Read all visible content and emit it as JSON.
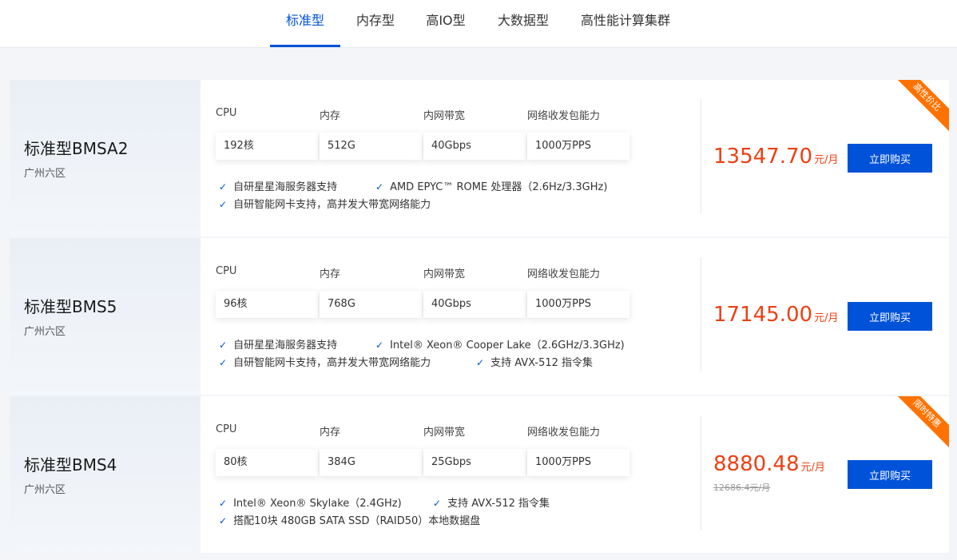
{
  "tabs": [
    {
      "label": "标准型",
      "active": true
    },
    {
      "label": "内存型",
      "active": false
    },
    {
      "label": "高IO型",
      "active": false
    },
    {
      "label": "大数据型",
      "active": false
    },
    {
      "label": "高性能计算集群",
      "active": false
    }
  ],
  "spec_labels": {
    "cpu": "CPU",
    "memory": "内存",
    "bandwidth": "内网带宽",
    "pps": "网络收发包能力"
  },
  "buy_label": "立即购买",
  "price_unit": "元/月",
  "colors": {
    "accent": "#0052d9",
    "price": "#ed4014",
    "ribbon": "#ff7200"
  },
  "products": [
    {
      "name": "标准型BMSA2",
      "region": "广州六区",
      "cpu": "192核",
      "memory": "512G",
      "bandwidth": "40Gbps",
      "pps": "1000万PPS",
      "features": [
        "自研星星海服务器支持",
        "AMD EPYC™ ROME 处理器（2.6Hz/3.3GHz)",
        "自研智能网卡支持，高并发大带宽网络能力"
      ],
      "price": "13547.70",
      "ribbon": "高性价比"
    },
    {
      "name": "标准型BMS5",
      "region": "广州六区",
      "cpu": "96核",
      "memory": "768G",
      "bandwidth": "40Gbps",
      "pps": "1000万PPS",
      "features": [
        "自研星星海服务器支持",
        "Intel® Xeon® Cooper Lake（2.6GHz/3.3GHz)",
        "自研智能网卡支持，高并发大带宽网络能力",
        "支持 AVX-512 指令集"
      ],
      "price": "17145.00"
    },
    {
      "name": "标准型BMS4",
      "region": "广州六区",
      "cpu": "80核",
      "memory": "384G",
      "bandwidth": "25Gbps",
      "pps": "1000万PPS",
      "features": [
        "Intel® Xeon® Skylake（2.4GHz)",
        "支持 AVX-512 指令集",
        "搭配10块 480GB SATA SSD（RAID50）本地数据盘"
      ],
      "price": "8880.48",
      "old_price": "12686.4元/月",
      "ribbon": "限时特惠"
    }
  ]
}
